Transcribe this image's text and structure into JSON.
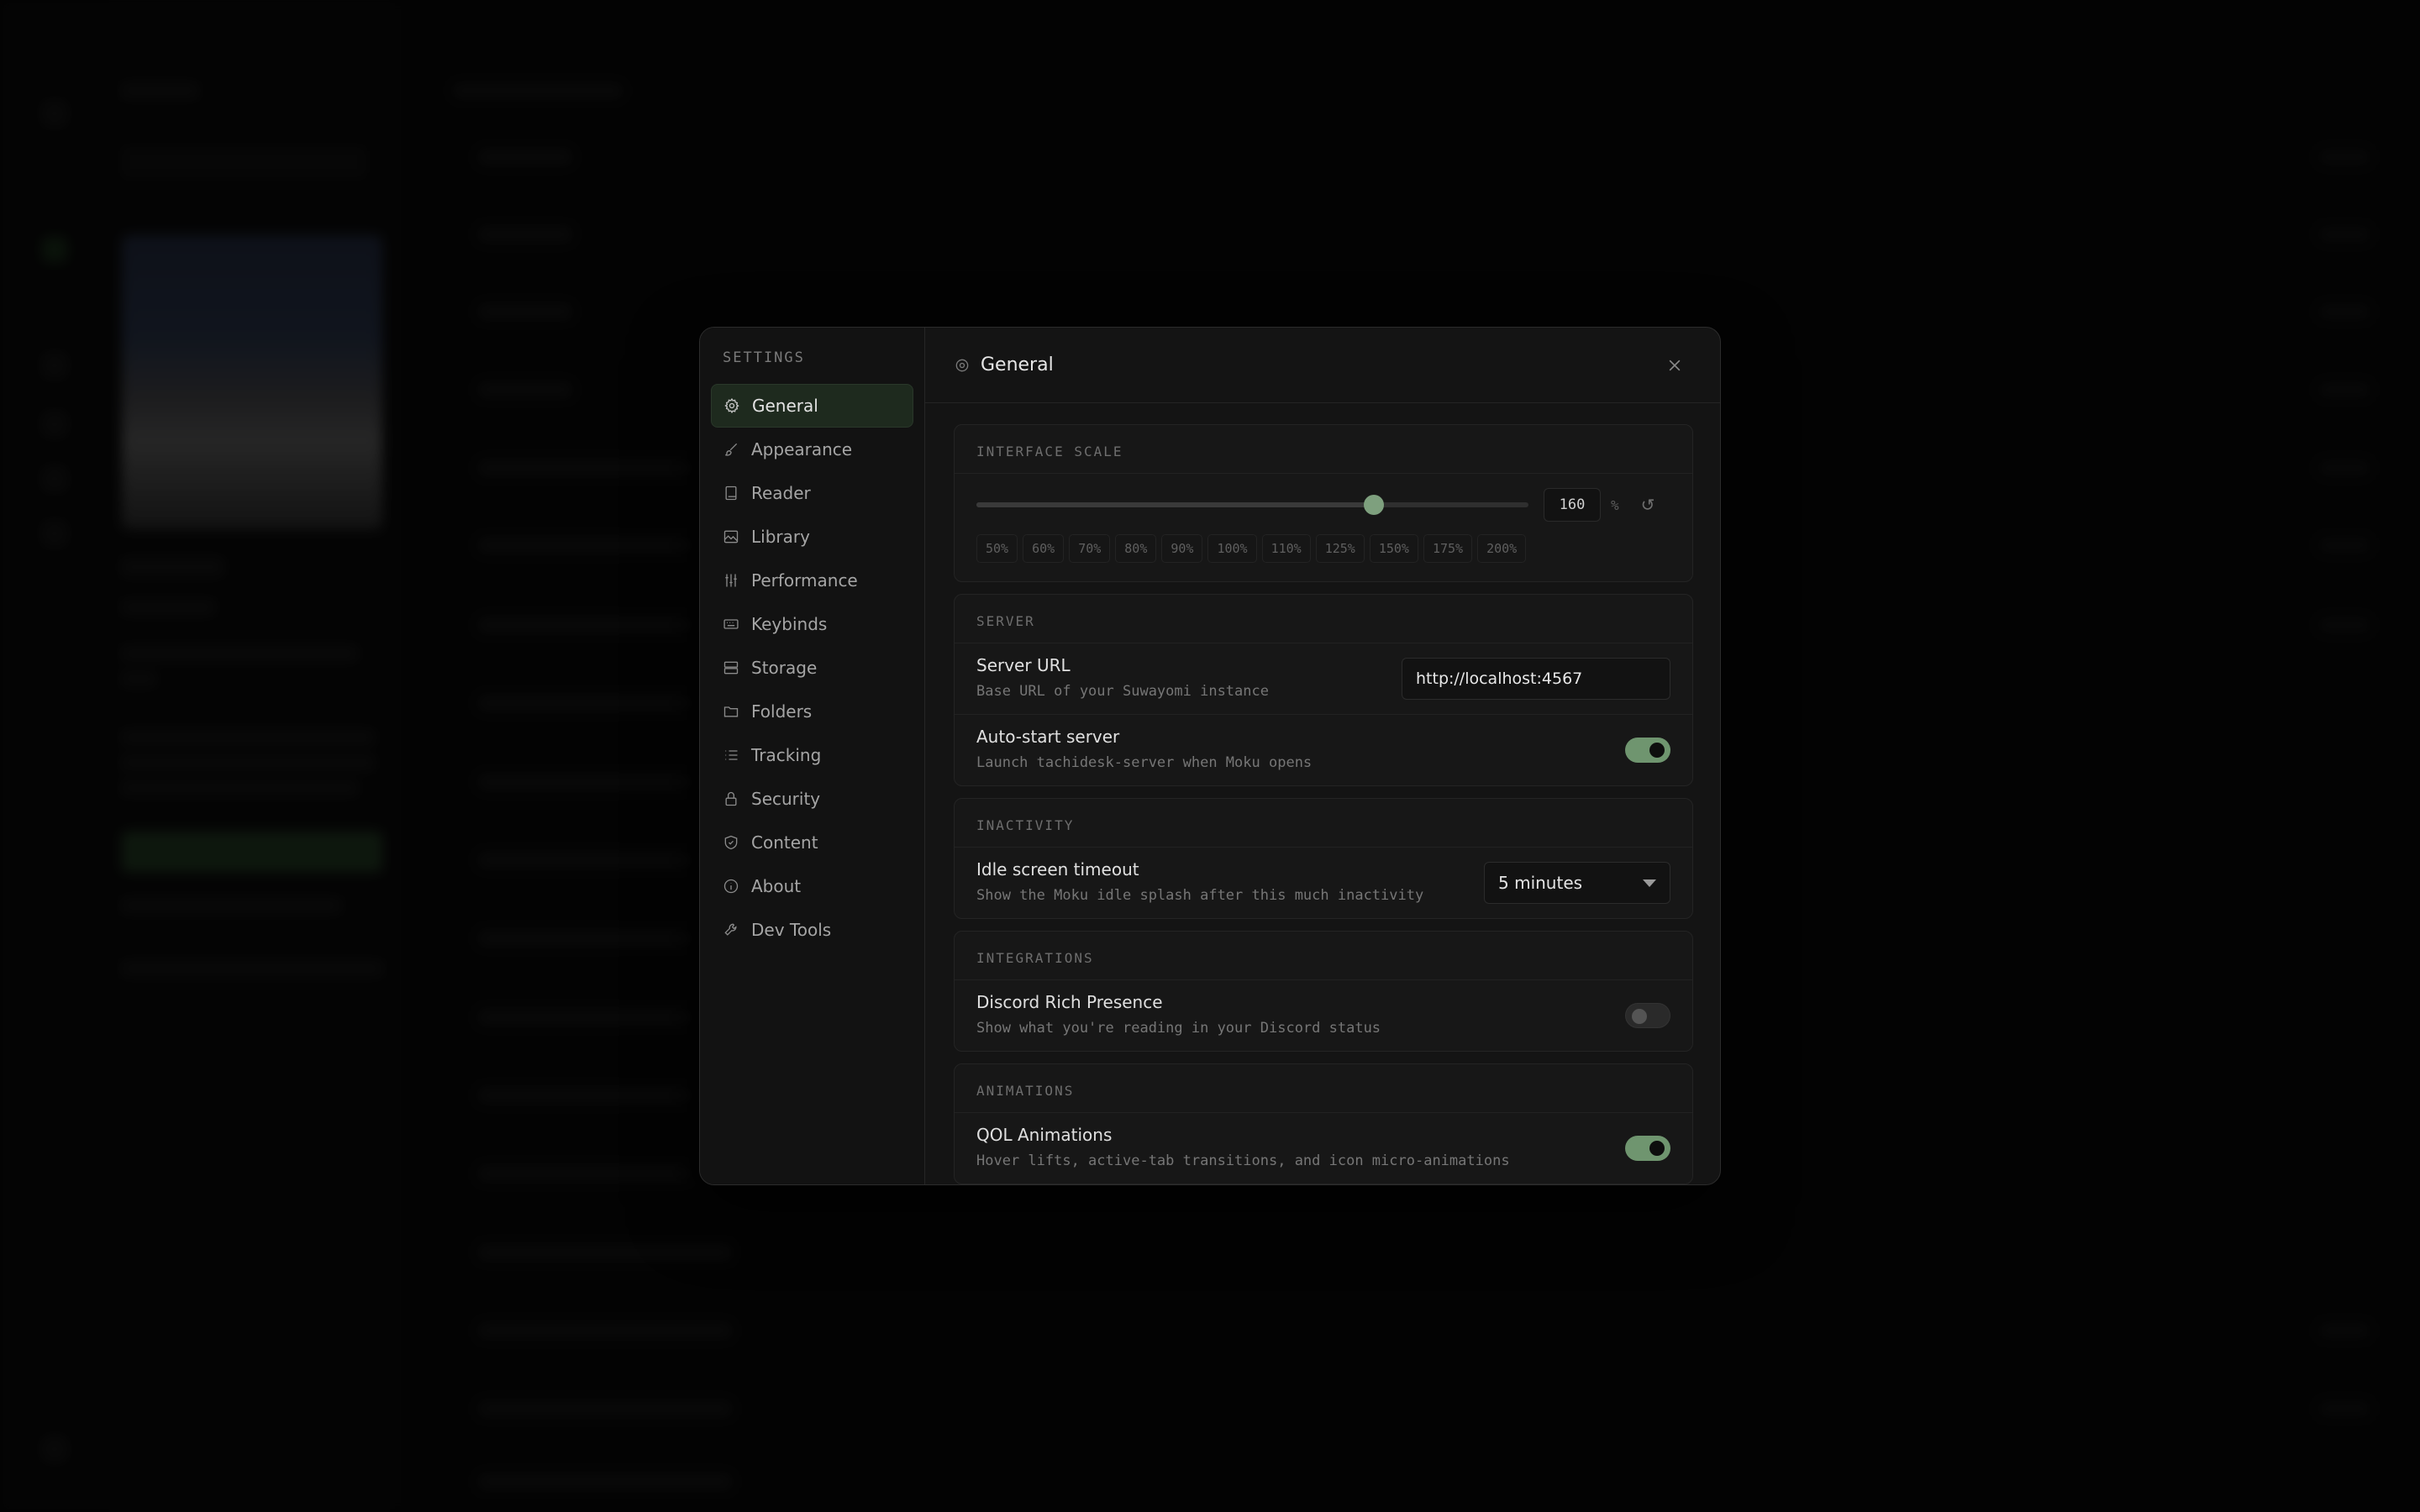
{
  "settings": {
    "title": "SETTINGS",
    "nav": [
      {
        "label": "General",
        "icon": "gear-icon",
        "active": true
      },
      {
        "label": "Appearance",
        "icon": "brush-icon"
      },
      {
        "label": "Reader",
        "icon": "book-icon"
      },
      {
        "label": "Library",
        "icon": "image-icon"
      },
      {
        "label": "Performance",
        "icon": "sliders-icon"
      },
      {
        "label": "Keybinds",
        "icon": "keyboard-icon"
      },
      {
        "label": "Storage",
        "icon": "database-icon"
      },
      {
        "label": "Folders",
        "icon": "folder-icon"
      },
      {
        "label": "Tracking",
        "icon": "list-icon"
      },
      {
        "label": "Security",
        "icon": "lock-icon"
      },
      {
        "label": "Content",
        "icon": "shield-icon"
      },
      {
        "label": "About",
        "icon": "info-icon"
      },
      {
        "label": "Dev Tools",
        "icon": "wrench-icon"
      }
    ]
  },
  "panel": {
    "title": "General",
    "icon": "gear-icon",
    "close_icon": "close-icon"
  },
  "interface_scale": {
    "section_title": "INTERFACE SCALE",
    "value": "160",
    "unit": "%",
    "reset_glyph": "↺",
    "slider_fraction": 0.72,
    "presets": [
      "50%",
      "60%",
      "70%",
      "80%",
      "90%",
      "100%",
      "110%",
      "125%",
      "150%",
      "175%",
      "200%"
    ]
  },
  "server": {
    "section_title": "SERVER",
    "url_label": "Server URL",
    "url_desc": "Base URL of your Suwayomi instance",
    "url_value": "http://localhost:4567",
    "autostart_label": "Auto-start server",
    "autostart_desc": "Launch tachidesk-server when Moku opens",
    "autostart_on": true
  },
  "inactivity": {
    "section_title": "INACTIVITY",
    "idle_label": "Idle screen timeout",
    "idle_desc": "Show the Moku idle splash after this much inactivity",
    "idle_value": "5 minutes"
  },
  "integrations": {
    "section_title": "INTEGRATIONS",
    "discord_label": "Discord Rich Presence",
    "discord_desc": "Show what you're reading in your Discord status",
    "discord_on": false
  },
  "animations": {
    "section_title": "ANIMATIONS",
    "qol_label": "QOL Animations",
    "qol_desc": "Hover lifts, active-tab transitions, and icon micro-animations",
    "qol_on": true
  },
  "colors": {
    "accent": "#6f956f",
    "active_nav_bg": "#1e2a1e",
    "modal_bg": "#141414"
  }
}
